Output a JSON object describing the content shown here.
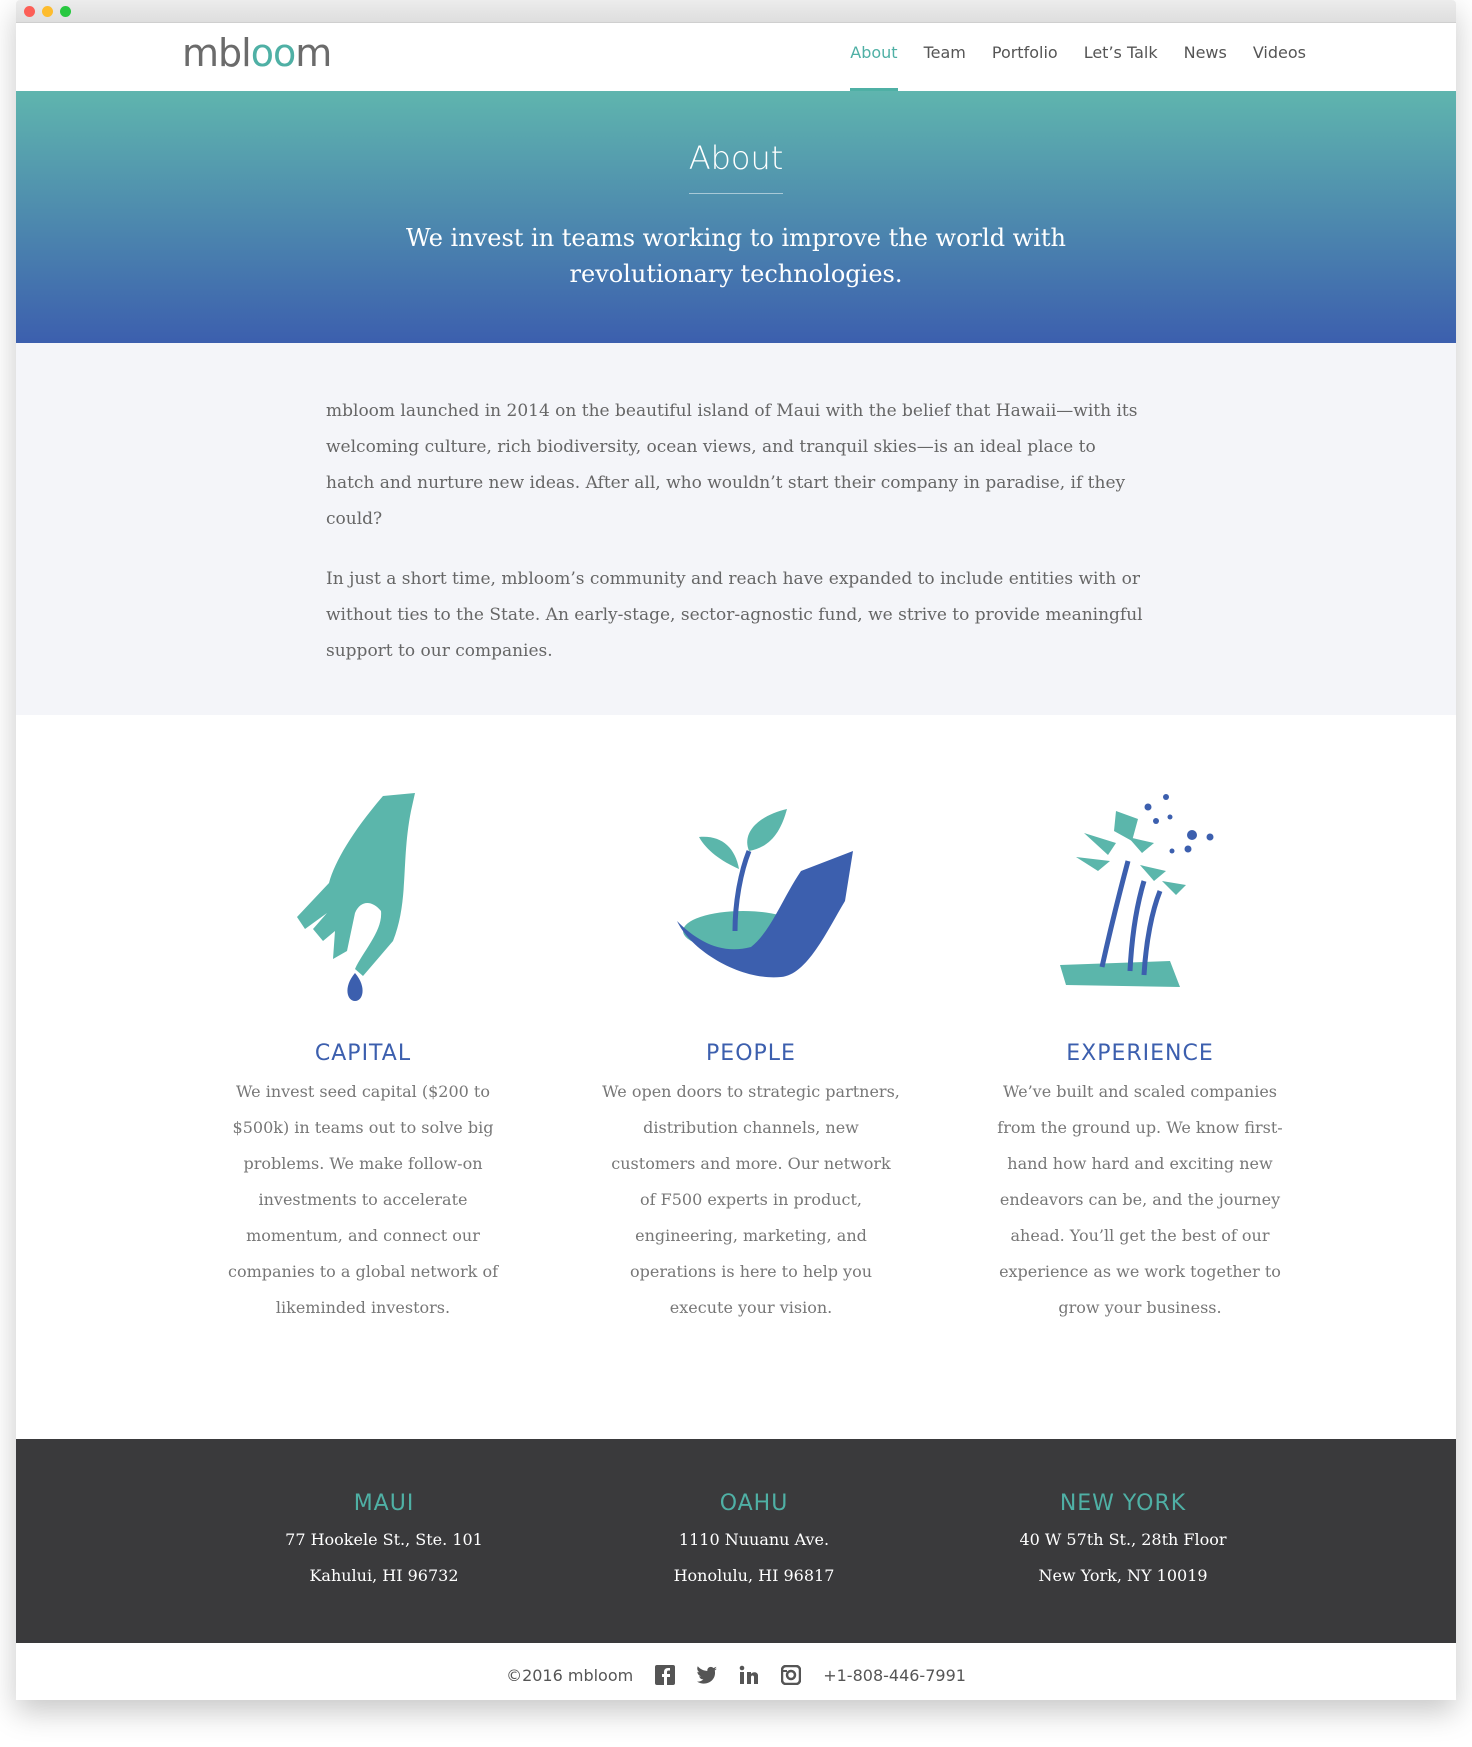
{
  "brand": {
    "name": "mbloom"
  },
  "nav": {
    "items": [
      "About",
      "Team",
      "Portfolio",
      "Let’s Talk",
      "News",
      "Videos"
    ]
  },
  "hero": {
    "title": "About",
    "subtitle": "We invest in teams working to improve the world with revolutionary technologies."
  },
  "intro": {
    "p1": "mbloom launched in 2014 on the beautiful island of Maui with the belief that Hawaii—with its welcoming culture, rich biodiversity, ocean views, and tranquil skies—is an ideal place to hatch and nurture new ideas. After all, who wouldn’t start their company in paradise, if they could?",
    "p2": "In just a short time, mbloom’s community and reach have expanded to include entities with or without ties to the State. An early-stage, sector-agnostic fund, we strive to provide meaningful support to our companies."
  },
  "features": [
    {
      "icon": "hand-seed-icon",
      "title": "CAPITAL",
      "text": "We invest seed capital ($200 to $500k) in teams out to solve big problems. We make follow-on investments to accelerate momentum, and connect our companies to a global network of likeminded investors."
    },
    {
      "icon": "hand-sprout-icon",
      "title": "PEOPLE",
      "text": "We open doors to strategic partners, distribution channels, new customers and more. Our network of F500 experts in product, engineering, marketing, and operations is here to help you execute your vision."
    },
    {
      "icon": "tree-icon",
      "title": "EXPERIENCE",
      "text": "We’ve built and scaled companies from the ground up. We know first-hand how hard and exciting new endeavors can be, and the journey ahead. You’ll get the best of our experience as we work together to grow your business."
    }
  ],
  "offices": [
    {
      "name": "MAUI",
      "line1": "77 Hookele St., Ste. 101",
      "line2": "Kahului, HI 96732"
    },
    {
      "name": "OAHU",
      "line1": "1110 Nuuanu Ave.",
      "line2": "Honolulu, HI 96817"
    },
    {
      "name": "NEW YORK",
      "line1": "40 W 57th St., 28th Floor",
      "line2": "New York, NY 10019"
    }
  ],
  "bottom": {
    "copyright": "©2016 mbloom",
    "social": [
      "facebook-icon",
      "twitter-icon",
      "linkedin-icon",
      "instagram-icon"
    ],
    "phone": "+1-808-446-7991"
  },
  "colors": {
    "teal": "#4fb0a5",
    "blue": "#3c5fae",
    "footer": "#3a3a3c"
  }
}
